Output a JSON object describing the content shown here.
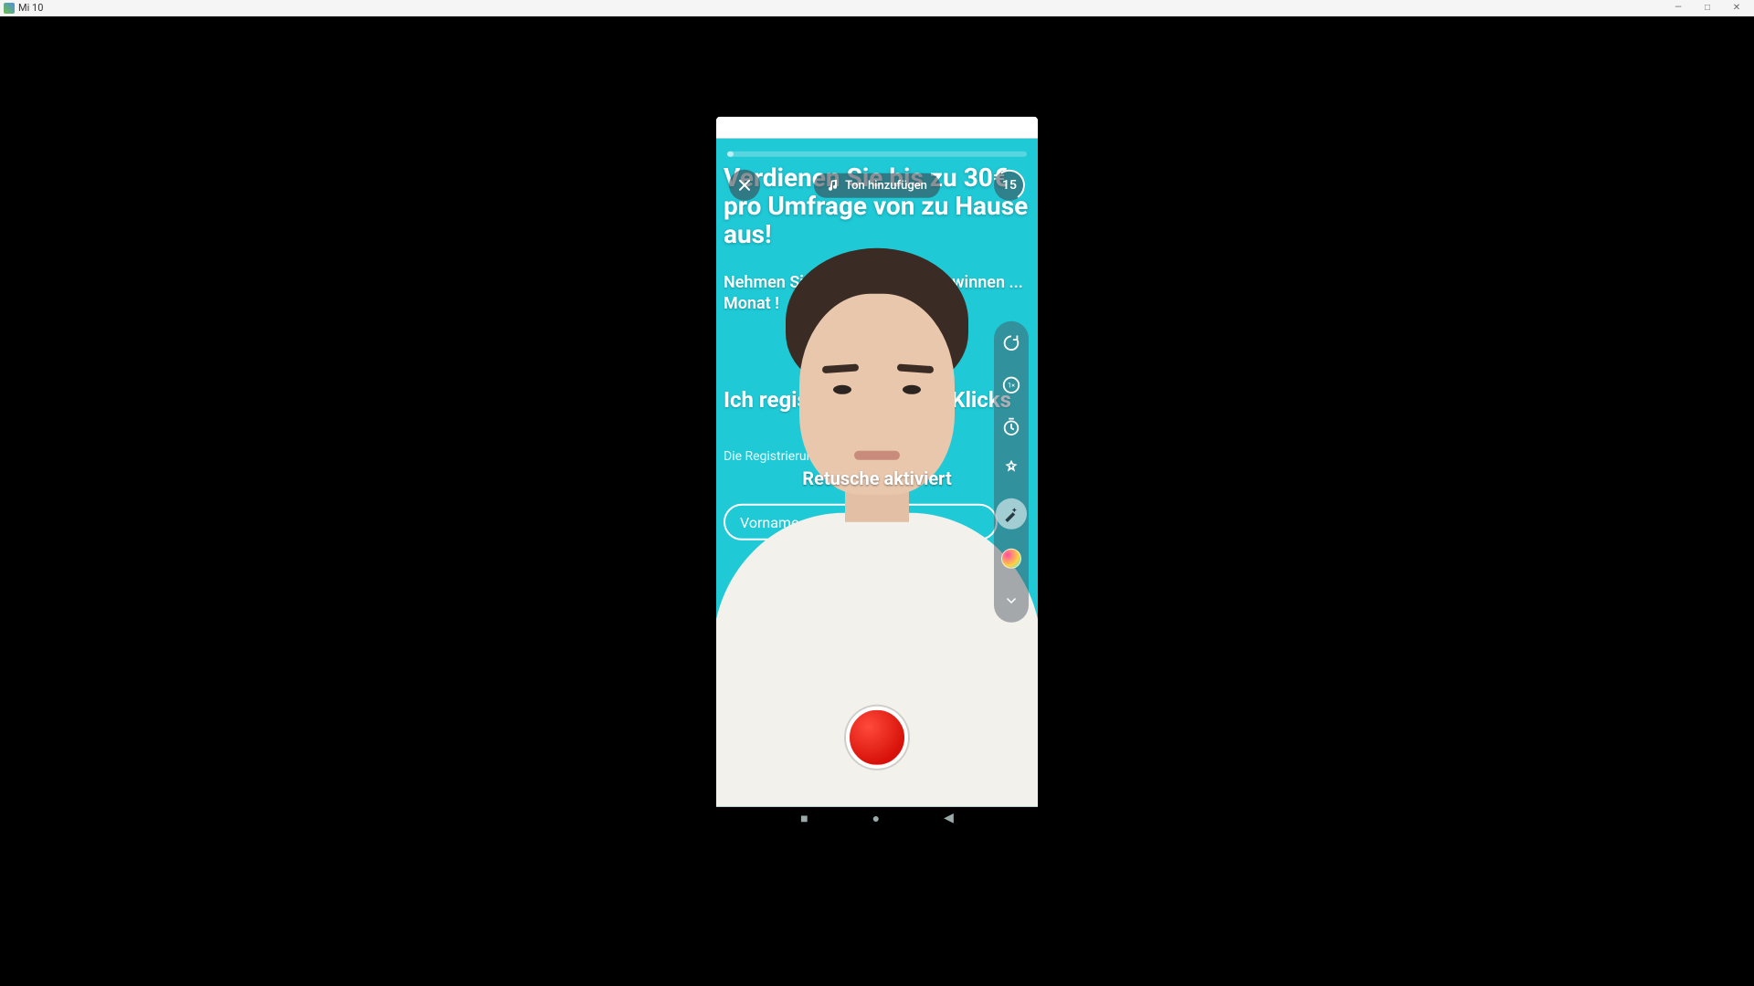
{
  "window": {
    "title": "Mi 10",
    "controls": {
      "minimize": "—",
      "maximize": "□",
      "close": "✕"
    }
  },
  "camera": {
    "progress_pct": 2,
    "close_icon_name": "close-icon",
    "sound_label": "Ton hinzufügen",
    "countdown_value": "15",
    "toast": "Retusche aktiviert",
    "record_label": "record",
    "tools": [
      {
        "name": "flip-camera-icon"
      },
      {
        "name": "speed-1x-icon",
        "badge": "1×"
      },
      {
        "name": "timer-icon"
      },
      {
        "name": "beauty-icon"
      },
      {
        "name": "magic-icon",
        "accent": true
      },
      {
        "name": "filters-icon"
      },
      {
        "name": "expand-down-icon"
      }
    ]
  },
  "background": {
    "headline": "Verdienen Sie bis zu 30€ pro Umfrage von zu Hause aus!",
    "subtext": "Nehmen Sie an\nUmfragen ...\ngewinnen ...\nMonat !",
    "line3": "Ich registriere ... nigen Klicks",
    "line4": "Die Registrierung",
    "input_placeholder": "Vorname"
  },
  "nav": {
    "recent": "■",
    "home": "●",
    "back": "◀"
  },
  "colors": {
    "teal": "#1fc9d6",
    "record_red": "#d8120a"
  }
}
